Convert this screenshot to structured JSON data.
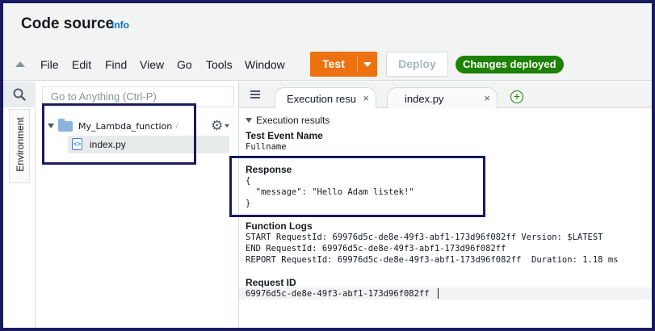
{
  "header": {
    "title": "Code source",
    "info_link": "Info"
  },
  "menu": [
    "File",
    "Edit",
    "Find",
    "View",
    "Go",
    "Tools",
    "Window"
  ],
  "toolbar": {
    "test_label": "Test",
    "deploy_label": "Deploy",
    "status_badge": "Changes deployed",
    "test_color": "#ec7211",
    "badge_color": "#1d8102"
  },
  "sidebar": {
    "goto_placeholder": "Go to Anything (Ctrl-P)",
    "environment_tab": "Environment",
    "folder": {
      "name": "My_Lambda_function",
      "suffix": "- /"
    },
    "file": {
      "name": "index.py"
    }
  },
  "tabs": [
    {
      "label": "Execution results"
    },
    {
      "label": "index.py"
    }
  ],
  "output": {
    "section_header": "Execution results",
    "test_event_title": "Test Event Name",
    "test_event_value": "Fullname",
    "response_title": "Response",
    "response_lines": [
      "{",
      "  \"message\": \"Hello Adam listek!\"",
      "}"
    ],
    "logs_title": "Function Logs",
    "log_lines": [
      "START RequestId: 69976d5c-de8e-49f3-abf1-173d96f082ff Version: $LATEST",
      "END RequestId: 69976d5c-de8e-49f3-abf1-173d96f082ff",
      "REPORT RequestId: 69976d5c-de8e-49f3-abf1-173d96f082ff  Duration: 1.18 ms"
    ],
    "request_id_title": "Request ID",
    "request_id_value": "69976d5c-de8e-49f3-abf1-173d96f082ff"
  }
}
